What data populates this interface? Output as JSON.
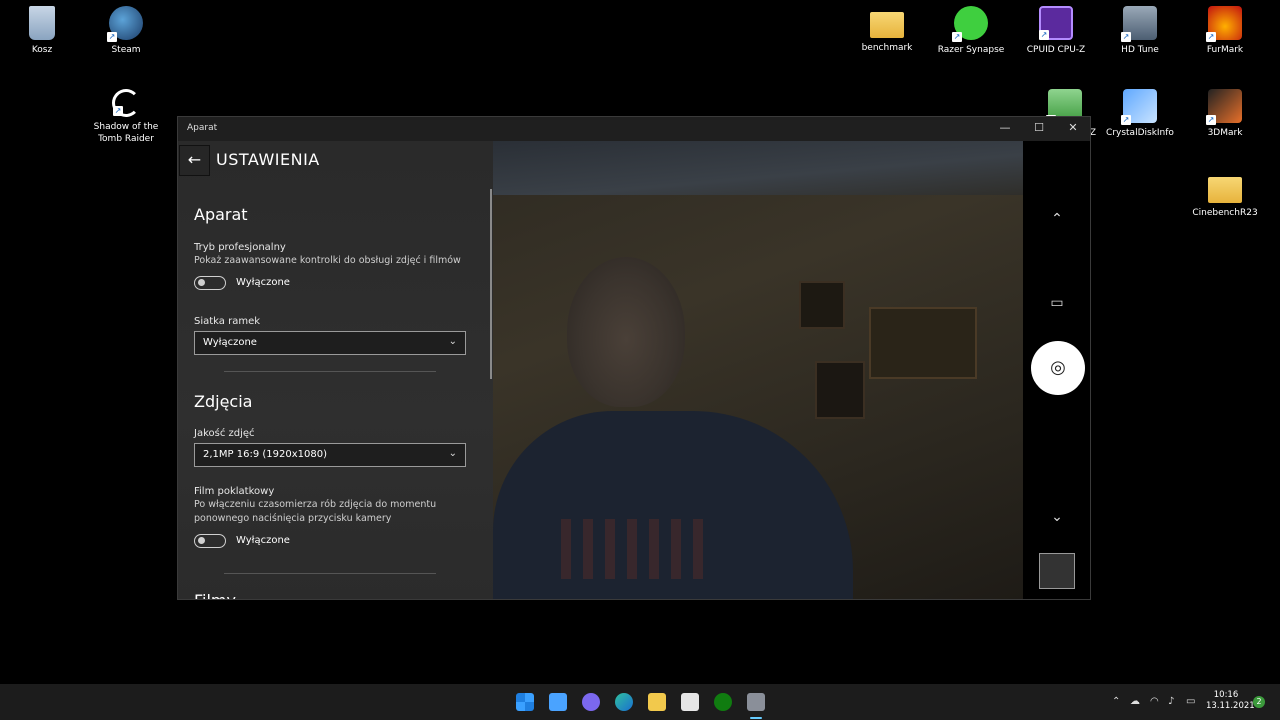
{
  "desktop": {
    "icons": [
      {
        "label": "Kosz",
        "icon": "recycle-bin-icon"
      },
      {
        "label": "Steam",
        "icon": "steam-icon"
      },
      {
        "label": "Shadow of the\nTomb Raider",
        "icon": "game-icon"
      },
      {
        "label": "benchmark",
        "icon": "folder-icon"
      },
      {
        "label": "Razer Synapse",
        "icon": "razer-icon"
      },
      {
        "label": "CPUID CPU-Z",
        "icon": "cpuz-icon"
      },
      {
        "label": "HD Tune",
        "icon": "hdtune-icon"
      },
      {
        "label": "FurMark",
        "icon": "furmark-icon"
      },
      {
        "label": "Z",
        "icon": "gpuz-icon"
      },
      {
        "label": "CrystalDiskInfo",
        "icon": "crystaldiskinfo-icon"
      },
      {
        "label": "3DMark",
        "icon": "3dmark-icon"
      },
      {
        "label": "CinebenchR23",
        "icon": "folder-icon"
      }
    ]
  },
  "window": {
    "title": "Aparat",
    "minimize": "—",
    "maximize": "☐",
    "close": "✕"
  },
  "settings": {
    "header": "USTAWIENIA",
    "back_glyph": "←",
    "section_camera": "Aparat",
    "pro_mode_label": "Tryb profesjonalny",
    "pro_mode_desc": "Pokaż zaawansowane kontrolki do obsługi zdjęć i filmów",
    "pro_mode_state": "Wyłączone",
    "grid_label": "Siatka ramek",
    "grid_value": "Wyłączone",
    "section_photos": "Zdjęcia",
    "quality_label": "Jakość zdjęć",
    "quality_value": "2,1MP 16:9 (1920x1080)",
    "timelapse_label": "Film poklatkowy",
    "timelapse_desc": "Po włączeniu czasomierza rób zdjęcia do momentu ponownego naciśnięcia przycisku kamery",
    "timelapse_state": "Wyłączone",
    "section_videos": "Filmy"
  },
  "controls": {
    "up": "⌃",
    "video": "▭",
    "shutter": "◎",
    "down": "⌄"
  },
  "taskbar": {
    "time": "10:16",
    "date": "13.11.2021",
    "notifications": "2"
  }
}
